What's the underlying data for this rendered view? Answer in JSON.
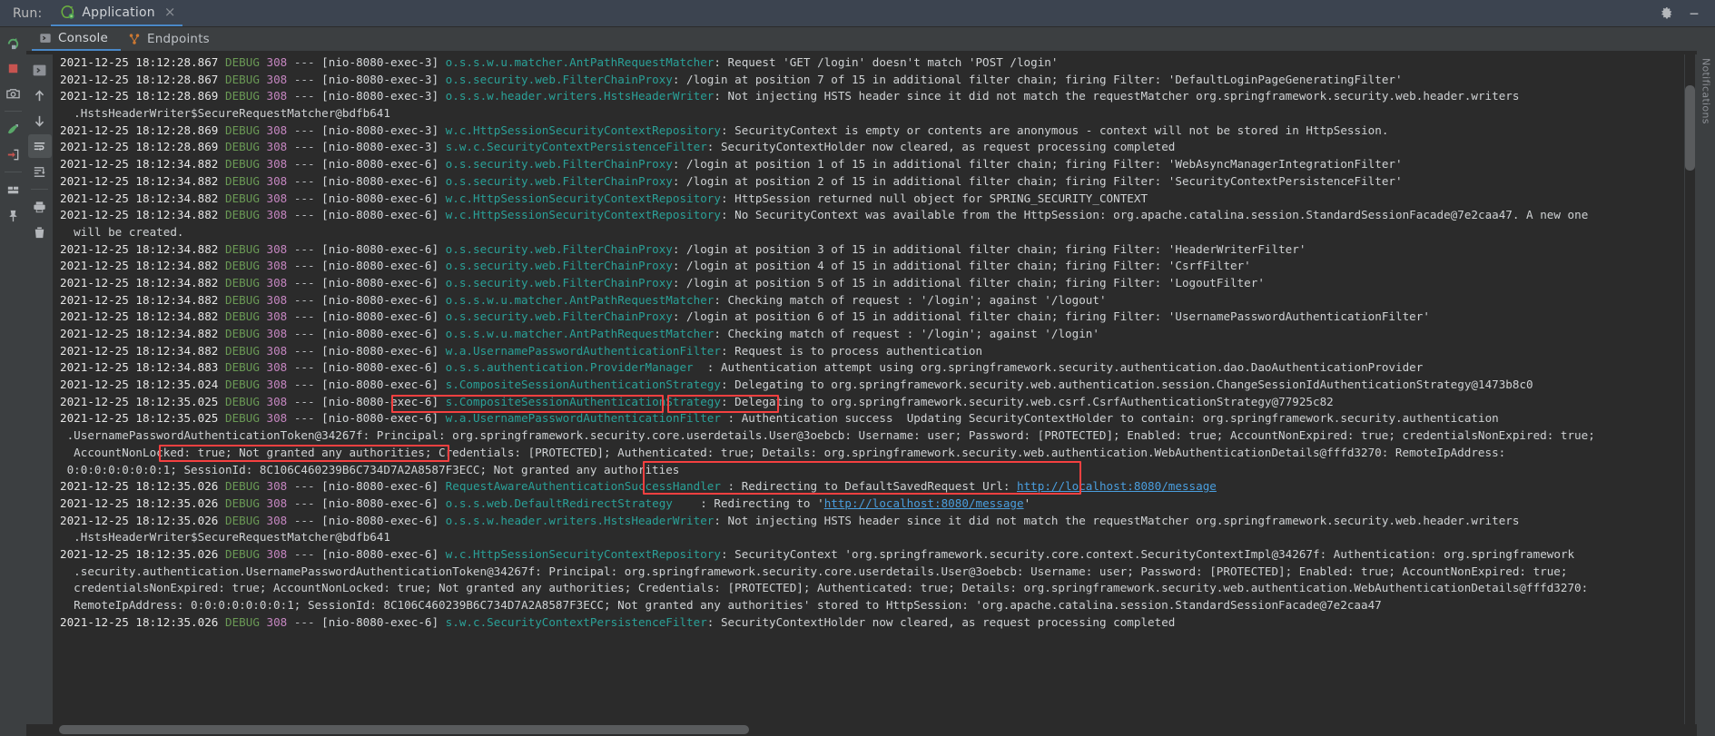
{
  "window": {
    "run_label": "Run:",
    "tab_title": "Application",
    "tab_close": "×",
    "gear_icon": "gear-icon",
    "minimize_icon": "minimize-icon",
    "app_icon": "spring-boot-icon"
  },
  "left_toolbar": {
    "primary": [
      {
        "name": "rerun-button",
        "icon": "rerun-icon",
        "title": "Rerun"
      },
      {
        "name": "stop-button",
        "icon": "stop-icon",
        "title": "Stop"
      },
      {
        "name": "screenshot-button",
        "icon": "camera-icon",
        "title": "Screenshot"
      },
      {
        "name": "spring-actuator-button",
        "icon": "spring-leaf-icon",
        "title": "Spring"
      },
      {
        "name": "exit-button",
        "icon": "exit-arrow-icon",
        "title": "Exit"
      },
      {
        "name": "layout-button",
        "icon": "layout-icon",
        "title": "Layout"
      },
      {
        "name": "pin-button",
        "icon": "pin-icon",
        "title": "Pin Tab"
      }
    ],
    "secondary": [
      {
        "name": "expand-tab-button",
        "icon": "chevron-right-box-icon",
        "title": "Show Console"
      },
      {
        "name": "scroll-up-button",
        "icon": "arrow-up-icon",
        "title": "Up the Stack Trace"
      },
      {
        "name": "scroll-down-button",
        "icon": "arrow-down-icon",
        "title": "Down the Stack Trace"
      },
      {
        "name": "soft-wrap-button",
        "icon": "soft-wrap-icon",
        "title": "Soft-Wrap",
        "active": true
      },
      {
        "name": "scroll-to-end-button",
        "icon": "scroll-to-end-icon",
        "title": "Scroll to End"
      },
      {
        "name": "print-button",
        "icon": "printer-icon",
        "title": "Print"
      },
      {
        "name": "clear-all-button",
        "icon": "trash-icon",
        "title": "Clear All"
      }
    ]
  },
  "tabs": [
    {
      "name": "tab-console",
      "label": "Console",
      "icon": "console-icon",
      "selected": true
    },
    {
      "name": "tab-endpoints",
      "label": "Endpoints",
      "icon": "endpoints-icon",
      "selected": false
    }
  ],
  "right_stripe_label": "Notifications",
  "console": {
    "lines": [
      {
        "ts": "2021-12-25 18:12:28.867",
        "lvl": "DEBUG",
        "pid": "308",
        "thread": "[nio-8080-exec-3]",
        "logger": "o.s.s.w.u.matcher.AntPathRequestMatcher",
        "msg": ": Request 'GET /login' doesn't match 'POST /login'"
      },
      {
        "ts": "2021-12-25 18:12:28.867",
        "lvl": "DEBUG",
        "pid": "308",
        "thread": "[nio-8080-exec-3]",
        "logger": "o.s.security.web.FilterChainProxy",
        "msg": ": /login at position 7 of 15 in additional filter chain; firing Filter: 'DefaultLoginPageGeneratingFilter'"
      },
      {
        "ts": "2021-12-25 18:12:28.869",
        "lvl": "DEBUG",
        "pid": "308",
        "thread": "[nio-8080-exec-3]",
        "logger": "o.s.s.w.header.writers.HstsHeaderWriter",
        "msg": ": Not injecting HSTS header since it did not match the requestMatcher org.springframework.security.web.header.writers"
      },
      {
        "cont": "  .HstsHeaderWriter$SecureRequestMatcher@bdfb641"
      },
      {
        "ts": "2021-12-25 18:12:28.869",
        "lvl": "DEBUG",
        "pid": "308",
        "thread": "[nio-8080-exec-3]",
        "logger": "w.c.HttpSessionSecurityContextRepository",
        "msg": ": SecurityContext is empty or contents are anonymous - context will not be stored in HttpSession."
      },
      {
        "ts": "2021-12-25 18:12:28.869",
        "lvl": "DEBUG",
        "pid": "308",
        "thread": "[nio-8080-exec-3]",
        "logger": "s.w.c.SecurityContextPersistenceFilter",
        "msg": ": SecurityContextHolder now cleared, as request processing completed"
      },
      {
        "ts": "2021-12-25 18:12:34.882",
        "lvl": "DEBUG",
        "pid": "308",
        "thread": "[nio-8080-exec-6]",
        "logger": "o.s.security.web.FilterChainProxy",
        "msg": ": /login at position 1 of 15 in additional filter chain; firing Filter: 'WebAsyncManagerIntegrationFilter'"
      },
      {
        "ts": "2021-12-25 18:12:34.882",
        "lvl": "DEBUG",
        "pid": "308",
        "thread": "[nio-8080-exec-6]",
        "logger": "o.s.security.web.FilterChainProxy",
        "msg": ": /login at position 2 of 15 in additional filter chain; firing Filter: 'SecurityContextPersistenceFilter'"
      },
      {
        "ts": "2021-12-25 18:12:34.882",
        "lvl": "DEBUG",
        "pid": "308",
        "thread": "[nio-8080-exec-6]",
        "logger": "w.c.HttpSessionSecurityContextRepository",
        "msg": ": HttpSession returned null object for SPRING_SECURITY_CONTEXT"
      },
      {
        "ts": "2021-12-25 18:12:34.882",
        "lvl": "DEBUG",
        "pid": "308",
        "thread": "[nio-8080-exec-6]",
        "logger": "w.c.HttpSessionSecurityContextRepository",
        "msg": ": No SecurityContext was available from the HttpSession: org.apache.catalina.session.StandardSessionFacade@7e2caa47. A new one"
      },
      {
        "cont": "  will be created."
      },
      {
        "ts": "2021-12-25 18:12:34.882",
        "lvl": "DEBUG",
        "pid": "308",
        "thread": "[nio-8080-exec-6]",
        "logger": "o.s.security.web.FilterChainProxy",
        "msg": ": /login at position 3 of 15 in additional filter chain; firing Filter: 'HeaderWriterFilter'"
      },
      {
        "ts": "2021-12-25 18:12:34.882",
        "lvl": "DEBUG",
        "pid": "308",
        "thread": "[nio-8080-exec-6]",
        "logger": "o.s.security.web.FilterChainProxy",
        "msg": ": /login at position 4 of 15 in additional filter chain; firing Filter: 'CsrfFilter'"
      },
      {
        "ts": "2021-12-25 18:12:34.882",
        "lvl": "DEBUG",
        "pid": "308",
        "thread": "[nio-8080-exec-6]",
        "logger": "o.s.security.web.FilterChainProxy",
        "msg": ": /login at position 5 of 15 in additional filter chain; firing Filter: 'LogoutFilter'"
      },
      {
        "ts": "2021-12-25 18:12:34.882",
        "lvl": "DEBUG",
        "pid": "308",
        "thread": "[nio-8080-exec-6]",
        "logger": "o.s.s.w.u.matcher.AntPathRequestMatcher",
        "msg": ": Checking match of request : '/login'; against '/logout'"
      },
      {
        "ts": "2021-12-25 18:12:34.882",
        "lvl": "DEBUG",
        "pid": "308",
        "thread": "[nio-8080-exec-6]",
        "logger": "o.s.security.web.FilterChainProxy",
        "msg": ": /login at position 6 of 15 in additional filter chain; firing Filter: 'UsernamePasswordAuthenticationFilter'"
      },
      {
        "ts": "2021-12-25 18:12:34.882",
        "lvl": "DEBUG",
        "pid": "308",
        "thread": "[nio-8080-exec-6]",
        "logger": "o.s.s.w.u.matcher.AntPathRequestMatcher",
        "msg": ": Checking match of request : '/login'; against '/login'"
      },
      {
        "ts": "2021-12-25 18:12:34.882",
        "lvl": "DEBUG",
        "pid": "308",
        "thread": "[nio-8080-exec-6]",
        "logger": "w.a.UsernamePasswordAuthenticationFilter",
        "msg": ": Request is to process authentication"
      },
      {
        "ts": "2021-12-25 18:12:34.883",
        "lvl": "DEBUG",
        "pid": "308",
        "thread": "[nio-8080-exec-6]",
        "logger": "o.s.s.authentication.ProviderManager",
        "msg": "  : Authentication attempt using org.springframework.security.authentication.dao.DaoAuthenticationProvider"
      },
      {
        "ts": "2021-12-25 18:12:35.024",
        "lvl": "DEBUG",
        "pid": "308",
        "thread": "[nio-8080-exec-6]",
        "logger": "s.CompositeSessionAuthenticationStrategy",
        "msg": ": Delegating to org.springframework.security.web.authentication.session.ChangeSessionIdAuthenticationStrategy@1473b8c0"
      },
      {
        "ts": "2021-12-25 18:12:35.025",
        "lvl": "DEBUG",
        "pid": "308",
        "thread": "[nio-8080-exec-6]",
        "logger": "s.CompositeSessionAuthenticationStrategy",
        "msg": ": Delegating to org.springframework.security.web.csrf.CsrfAuthenticationStrategy@77925c82"
      },
      {
        "ts": "2021-12-25 18:12:35.025",
        "lvl": "DEBUG",
        "pid": "308",
        "thread": "[nio-8080-exec-6]",
        "logger_prefix": "w.a.",
        "logger_boxed": "UsernamePasswordAuthenticationFilter",
        "msg_pre": " : ",
        "msg_boxed": "Authentication success",
        "msg_post": "  Updating SecurityContextHolder to contain: org.springframework.security.authentication",
        "highlight": "auth-success"
      },
      {
        "cont": " .UsernamePasswordAuthenticationToken@34267f: Principal: org.springframework.security.core.userdetails.User@3oebcb: Username: user; Password: [PROTECTED]; Enabled: true; AccountNonExpired: true; credentialsNonExpired: true;"
      },
      {
        "cont": "  AccountNonLocked: true; Not granted any authorities; Credentials: [PROTECTED]; Authenticated: true; Details: org.springframework.security.web.authentication.WebAuthenticationDetails@fffd3270: RemoteIpAddress:"
      },
      {
        "cont": " 0:0:0:0:0:0:0:1; SessionId: 8C106C460239B6C734D7A2A8587F3ECC; Not granted any authorities",
        "highlight": "session-id"
      },
      {
        "ts": "2021-12-25 18:12:35.026",
        "lvl": "DEBUG",
        "pid": "308",
        "thread": "[nio-8080-exec-6]",
        "logger": "RequestAwareAuthenticationSuccessHandler",
        "msg_pre": " : ",
        "msg_text": "Redirecting to DefaultSavedRequest Url: ",
        "url": "http://localhost:8080/message",
        "highlight": "redirect-1"
      },
      {
        "ts": "2021-12-25 18:12:35.026",
        "lvl": "DEBUG",
        "pid": "308",
        "thread": "[nio-8080-exec-6]",
        "logger": "o.s.s.web.DefaultRedirectStrategy",
        "msg_pre": "    : ",
        "msg_text": "Redirecting to '",
        "url": "http://localhost:8080/message",
        "msg_suffix": "'",
        "highlight": "redirect-2"
      },
      {
        "ts": "2021-12-25 18:12:35.026",
        "lvl": "DEBUG",
        "pid": "308",
        "thread": "[nio-8080-exec-6]",
        "logger": "o.s.s.w.header.writers.HstsHeaderWriter",
        "msg": ": Not injecting HSTS header since it did not match the requestMatcher org.springframework.security.web.header.writers"
      },
      {
        "cont": "  .HstsHeaderWriter$SecureRequestMatcher@bdfb641"
      },
      {
        "ts": "2021-12-25 18:12:35.026",
        "lvl": "DEBUG",
        "pid": "308",
        "thread": "[nio-8080-exec-6]",
        "logger": "w.c.HttpSessionSecurityContextRepository",
        "msg": ": SecurityContext 'org.springframework.security.core.context.SecurityContextImpl@34267f: Authentication: org.springframework"
      },
      {
        "cont": "  .security.authentication.UsernamePasswordAuthenticationToken@34267f: Principal: org.springframework.security.core.userdetails.User@3oebcb: Username: user; Password: [PROTECTED]; Enabled: true; AccountNonExpired: true;"
      },
      {
        "cont": "  credentialsNonExpired: true; AccountNonLocked: true; Not granted any authorities; Credentials: [PROTECTED]; Authenticated: true; Details: org.springframework.security.web.authentication.WebAuthenticationDetails@fffd3270:"
      },
      {
        "cont": "  RemoteIpAddress: 0:0:0:0:0:0:0:1; SessionId: 8C106C460239B6C734D7A2A8587F3ECC; Not granted any authorities' stored to HttpSession: 'org.apache.catalina.session.StandardSessionFacade@7e2caa47"
      },
      {
        "ts": "2021-12-25 18:12:35.026",
        "lvl": "DEBUG",
        "pid": "308",
        "thread": "[nio-8080-exec-6]",
        "logger": "s.w.c.SecurityContextPersistenceFilter",
        "msg": ": SecurityContextHolder now cleared, as request processing completed"
      }
    ]
  },
  "colors": {
    "bg_console": "#2b2b2b",
    "bg_toolbar": "#3c3f41",
    "bg_runbar": "#3c4450",
    "accent_tab": "#4a88c7",
    "level_debug": "#6a9955",
    "pid": "#c586c0",
    "logger": "#2aa198",
    "link": "#4a9ede",
    "highlight_box": "#f54040"
  }
}
